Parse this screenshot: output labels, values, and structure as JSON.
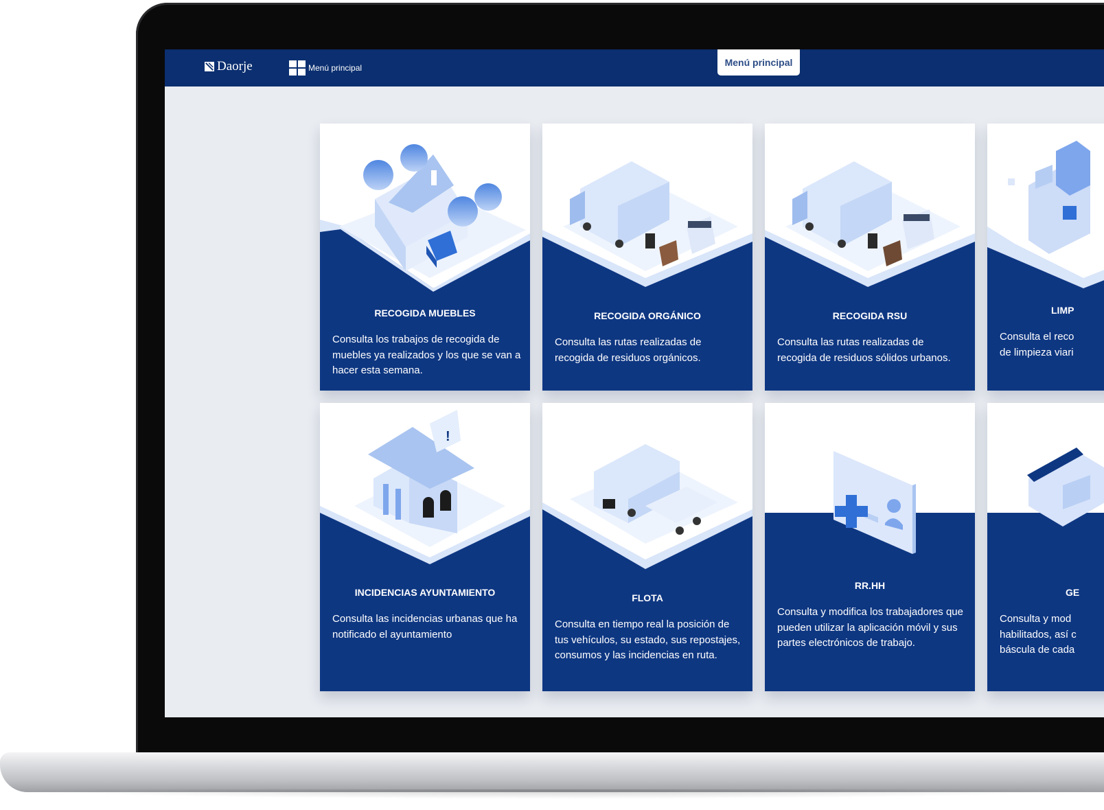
{
  "app": {
    "brand": "Daorje",
    "nav_menu_label": "Menú principal",
    "active_tab": "Menú principal"
  },
  "cards": [
    {
      "title": "RECOGIDA MUEBLES",
      "description": "Consulta los trabajos de recogida de muebles ya realizados y los que se van a hacer esta semana.",
      "icon": "house-furniture-illustration"
    },
    {
      "title": "RECOGIDA ORGÁNICO",
      "description": "Consulta las rutas realizadas de recogida de residuos orgánicos.",
      "icon": "garbage-trucks-illustration"
    },
    {
      "title": "RECOGIDA RSU",
      "description": "Consulta las rutas realizadas de recogida de residuos sólidos urbanos.",
      "icon": "garbage-trucks-bins-illustration"
    },
    {
      "title": "LIMP",
      "description": "Consulta el reco\nde limpieza viari",
      "icon": "city-cleaning-illustration"
    },
    {
      "title": "INCIDENCIAS AYUNTAMIENTO",
      "description": "Consulta las incidencias urbanas que ha notificado el ayuntamiento",
      "icon": "town-hall-alert-illustration"
    },
    {
      "title": "FLOTA",
      "description": "Consulta en tiempo real la posición de tus vehículos, su estado, sus repostajes, consumos y las incidencias en ruta.",
      "icon": "fleet-vehicles-illustration"
    },
    {
      "title": "RR.HH",
      "description": "Consulta y modifica los trabajadores que pueden utilizar la aplicación móvil y sus partes electrónicos de trabajo.",
      "icon": "employee-card-illustration"
    },
    {
      "title": "GE",
      "description": "Consulta y mod\nhabilitados, así c\nbáscula de cada",
      "icon": "recycling-plant-illustration"
    }
  ],
  "colors": {
    "navy": "#0b2f70",
    "card_blue": "#0e3782",
    "background": "#e9ecf1",
    "accent_light": "#7ea6ec"
  }
}
